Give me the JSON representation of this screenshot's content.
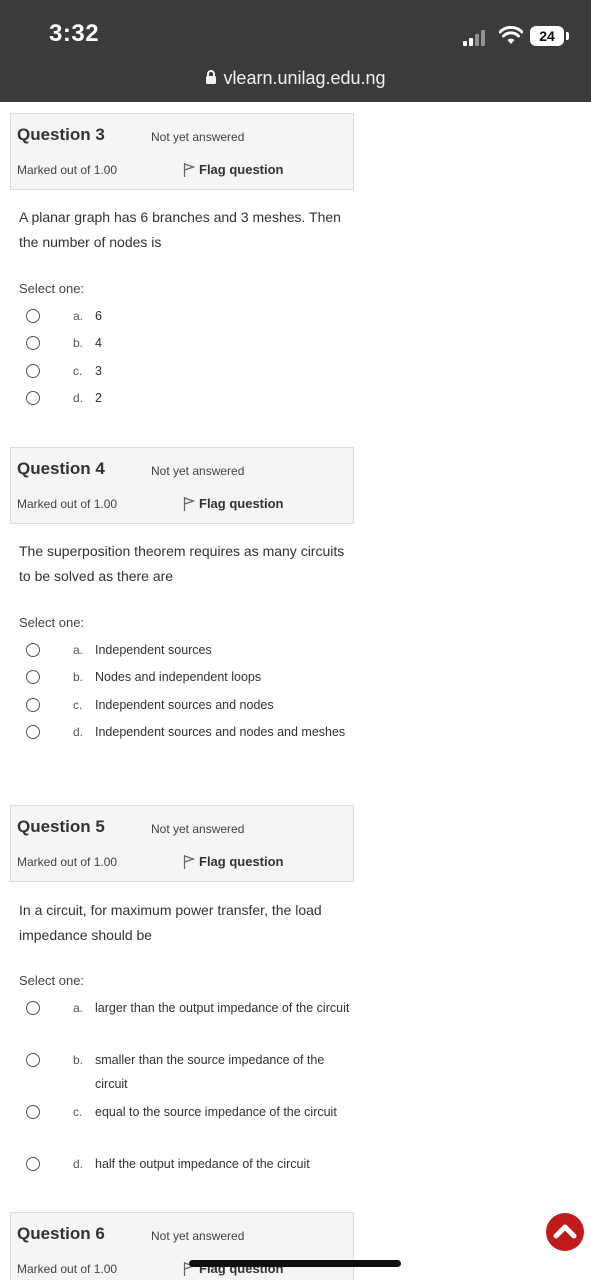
{
  "status_bar": {
    "time": "3:32",
    "battery": "24"
  },
  "browser": {
    "url": "vlearn.unilag.edu.ng"
  },
  "questions": [
    {
      "title": "Question 3",
      "state": "Not yet answered",
      "marks": "Marked out of 1.00",
      "flag_label": "Flag question",
      "text": "A planar graph has 6 branches and 3 meshes. Then the number of nodes is",
      "select_label": "Select one:",
      "options": [
        {
          "letter": "a.",
          "text": "6"
        },
        {
          "letter": "b.",
          "text": "4"
        },
        {
          "letter": "c.",
          "text": "3"
        },
        {
          "letter": "d.",
          "text": "2"
        }
      ]
    },
    {
      "title": "Question 4",
      "state": "Not yet answered",
      "marks": "Marked out of 1.00",
      "flag_label": "Flag question",
      "text": "The superposition theorem requires as many circuits to be solved as there are",
      "select_label": "Select one:",
      "options": [
        {
          "letter": "a.",
          "text": "Independent sources"
        },
        {
          "letter": "b.",
          "text": "Nodes and independent loops"
        },
        {
          "letter": "c.",
          "text": "Independent sources and nodes"
        },
        {
          "letter": "d.",
          "text": "Independent sources and nodes and meshes"
        }
      ]
    },
    {
      "title": "Question 5",
      "state": "Not yet answered",
      "marks": "Marked out of 1.00",
      "flag_label": "Flag question",
      "text": "In a circuit, for maximum power transfer, the load impedance should be",
      "select_label": "Select one:",
      "options": [
        {
          "letter": "a.",
          "text": "larger than the output impedance of the circuit"
        },
        {
          "letter": "b.",
          "text": "smaller than the source impedance of the circuit"
        },
        {
          "letter": "c.",
          "text": "equal to the source impedance of the circuit"
        },
        {
          "letter": "d.",
          "text": "half the output impedance of the circuit"
        }
      ]
    },
    {
      "title": "Question 6",
      "state": "Not yet answered",
      "marks": "Marked out of 1.00",
      "flag_label": "Flag question"
    }
  ],
  "colors": {
    "status_bar": "#3a3b3d",
    "scroll_button": "#c01a1a",
    "info_box": "#f5f5f5"
  },
  "icons": [
    "lock-icon",
    "signal-icon",
    "wifi-icon",
    "battery-icon",
    "flag-icon",
    "chevron-up-icon"
  ]
}
